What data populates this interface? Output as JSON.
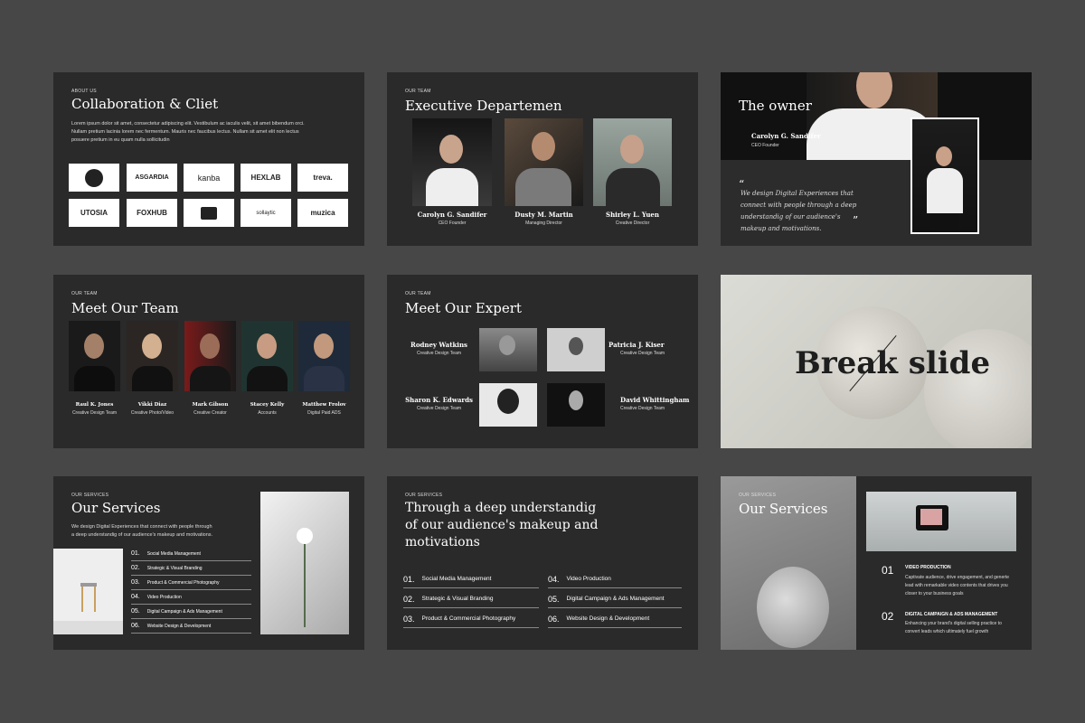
{
  "slide1": {
    "eyebrow": "ABOUT US",
    "title": "Collaboration & Cliet",
    "body": "Lorem ipsum dolor sit amet, consectetur adipiscing elit. Vestibulum ac iaculis velit, sit amet bibendum orci. Nullam pretium lacinia lorem nec fermentum. Mauris nec faucibus lectus. Nullam sit amet elit non lectus posuere pretium in eu quam nulla sollicitudin",
    "logos": [
      "ASGARDIA",
      "kanba",
      "HEXLAB",
      "treva.",
      "UTOSIA",
      "FOXHUB",
      "sollaytic",
      "muzica"
    ]
  },
  "slide2": {
    "eyebrow": "OUR TEAM",
    "title": "Executive Departemen",
    "people": [
      {
        "name": "Carolyn G. Sandifer",
        "role": "CEO Founder"
      },
      {
        "name": "Dusty M. Martin",
        "role": "Managing Director"
      },
      {
        "name": "Shirley L. Yuen",
        "role": "Creative Director"
      }
    ]
  },
  "slide3": {
    "title": "The owner",
    "name": "Carolyn G. Sandifer",
    "role": "CEO Founder",
    "quote": "We design Digital Experiences that connect with people through a deep understandig of our audience's makeup and motivations."
  },
  "slide4": {
    "eyebrow": "OUR TEAM",
    "title": "Meet Our Team",
    "people": [
      {
        "name": "Raul K. Jones",
        "role": "Creative Design Team"
      },
      {
        "name": "Vikki Diaz",
        "role": "Creative Photo/Video"
      },
      {
        "name": "Mark Gibson",
        "role": "Creative Creator"
      },
      {
        "name": "Stacey Kelly",
        "role": "Accounts"
      },
      {
        "name": "Matthew Frolov",
        "role": "Digital Paid ADS"
      }
    ]
  },
  "slide5": {
    "eyebrow": "OUR TEAM",
    "title": "Meet Our Expert",
    "people": [
      {
        "name": "Rodney Watkins",
        "role": "Creative Design Team"
      },
      {
        "name": "Patricia J. Kiser",
        "role": "Creative Design Team"
      },
      {
        "name": "Sharon K. Edwards",
        "role": "Creative Design Team"
      },
      {
        "name": "David Whittingham",
        "role": "Creative Design Team"
      }
    ]
  },
  "slide6": {
    "title": "Break slide"
  },
  "slide7": {
    "eyebrow": "OUR SERVICES",
    "title": "Our Services",
    "body": "We design Digital Experiences that connect with people through a deep understandig of our audience's makeup and motivations.",
    "services": [
      {
        "num": "01.",
        "label": "Social Media Management"
      },
      {
        "num": "02.",
        "label": "Strategic & Visual Branding"
      },
      {
        "num": "03.",
        "label": "Product & Commercial Photography"
      },
      {
        "num": "04.",
        "label": "Video Production"
      },
      {
        "num": "05.",
        "label": "Digital Campaign & Ads Management"
      },
      {
        "num": "06.",
        "label": "Website Design & Development"
      }
    ]
  },
  "slide8": {
    "eyebrow": "OUR SERVICES",
    "title_lines": [
      "Through a deep understandig",
      "of our audience's makeup and",
      "motivations"
    ],
    "services": [
      {
        "num": "01.",
        "label": "Social Media Management"
      },
      {
        "num": "02.",
        "label": "Strategic & Visual Branding"
      },
      {
        "num": "03.",
        "label": "Product & Commercial Photography"
      },
      {
        "num": "04.",
        "label": "Video Production"
      },
      {
        "num": "05.",
        "label": "Digital Campaign & Ads Management"
      },
      {
        "num": "06.",
        "label": "Website Design & Development"
      }
    ]
  },
  "slide9": {
    "eyebrow": "OUR SERVICES",
    "title": "Our Services",
    "items": [
      {
        "num": "01",
        "label": "VIDEO PRODUCTION",
        "desc": "Captivate audience, drive engagement, and generte lead with remarkable video contents that drives you closer to your business goals"
      },
      {
        "num": "02",
        "label": "DIGITAL CAMPAIGN & ADS MANAGEMENT",
        "desc": "Enhancing your brand's digital selling practice to convert leads which ultimately fuel growth"
      }
    ]
  }
}
